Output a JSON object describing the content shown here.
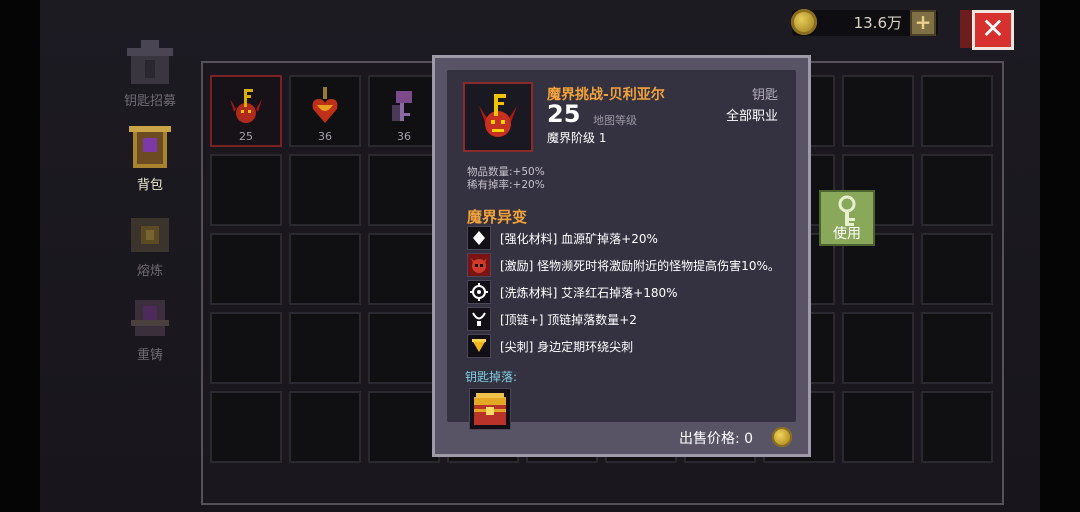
{
  "currency": {
    "amount": "13.6万",
    "plus_label": "+",
    "close_label": "✕"
  },
  "sidebar": {
    "items": [
      {
        "label": "钥匙招募",
        "icon": "key-recruit-icon",
        "active": false
      },
      {
        "label": "背包",
        "icon": "backpack-icon",
        "active": true
      },
      {
        "label": "熔炼",
        "icon": "smelt-icon",
        "active": false
      },
      {
        "label": "重铸",
        "icon": "reforge-icon",
        "active": false
      }
    ]
  },
  "inventory": {
    "slots": [
      {
        "count": "25",
        "icon": "demon-key-icon",
        "selected": true
      },
      {
        "count": "36",
        "icon": "heart-key-icon",
        "selected": false
      },
      {
        "count": "36",
        "icon": "purple-key-icon",
        "selected": false
      }
    ]
  },
  "use_button": {
    "label": "使用",
    "icon": "key-use-icon"
  },
  "item": {
    "title": "魔界挑战-贝利亚尔",
    "type": "钥匙",
    "level": "25",
    "level_label": "地图等级",
    "class": "全部职业",
    "tier": "魔界阶级 1",
    "stats": [
      "物品数量:+50%",
      "稀有掉率:+20%"
    ],
    "modifiers_title": "魔界异变",
    "modifiers": [
      {
        "text": "[强化材料] 血源矿掉落+20%",
        "icon": "diamond-icon"
      },
      {
        "text": "[激励] 怪物濒死时将激励附近的怪物提高伤害10%。",
        "icon": "demon-face-icon"
      },
      {
        "text": "[洗炼材料] 艾泽红石掉落+180%",
        "icon": "gear-icon"
      },
      {
        "text": "[顶链+] 顶链掉落数量+2",
        "icon": "necklace-icon"
      },
      {
        "text": "[尖刺] 身边定期环绕尖刺",
        "icon": "spike-icon"
      }
    ],
    "drop_label": "钥匙掉落:",
    "drop_icon": "treasure-chest-icon",
    "price_label": "出售价格: 0"
  }
}
